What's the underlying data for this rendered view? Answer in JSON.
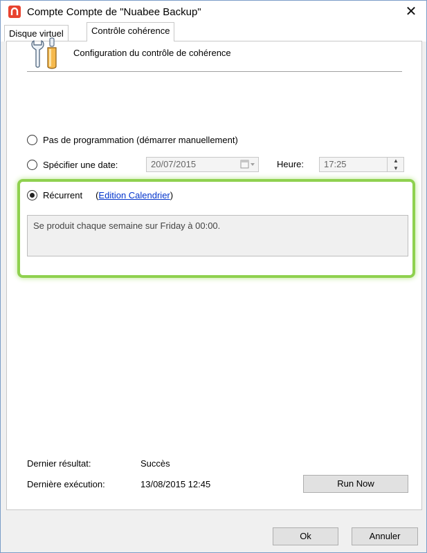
{
  "window": {
    "title": "Compte Compte de \"Nuabee Backup\"",
    "close_symbol": "✕",
    "accent_color": "#e8432f"
  },
  "tabs": [
    {
      "label": "Disque virtuel",
      "active": false
    },
    {
      "label": "Contrôle cohérence",
      "active": true
    }
  ],
  "section": {
    "icon": "wrench-screwdriver-icon",
    "title": "Configuration du contrôle de cohérence"
  },
  "options": {
    "manual": {
      "label": "Pas de programmation (démarrer manuellement)",
      "selected": false
    },
    "date": {
      "label": "Spécifier une date:",
      "selected": false,
      "date_value": "20/07/2015",
      "time_label": "Heure:",
      "time_value": "17:25"
    },
    "recurrent": {
      "label": "Récurrent",
      "selected": true,
      "link_open": "(",
      "link_text": "Edition Calendrier",
      "link_close": ")",
      "summary": "Se produit chaque semaine sur Friday à 00:00."
    }
  },
  "highlight_color": "#8fd14f",
  "status": {
    "last_result_label": "Dernier résultat:",
    "last_result_value": "Succès",
    "last_run_label": "Dernière exécution:",
    "last_run_value": "13/08/2015 12:45",
    "run_now_label": "Run Now"
  },
  "footer": {
    "ok_label": "Ok",
    "cancel_label": "Annuler"
  }
}
